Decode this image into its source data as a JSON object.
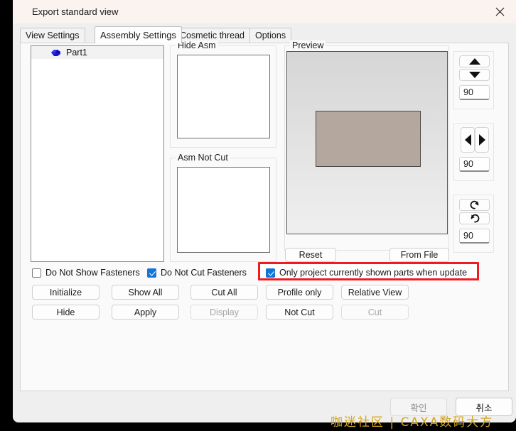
{
  "window": {
    "title": "Export standard view",
    "close_icon": "close-icon"
  },
  "tabs": [
    {
      "label": "View Settings",
      "selected": false
    },
    {
      "label": "Assembly Settings",
      "selected": true
    },
    {
      "label": "Cosmetic thread",
      "selected": false
    },
    {
      "label": "Options",
      "selected": false
    }
  ],
  "tree": {
    "items": [
      {
        "label": "Part1",
        "icon": "part-icon"
      }
    ]
  },
  "groups": {
    "hide_asm": "Hide Asm",
    "asm_not_cut": "Asm Not Cut",
    "preview": "Preview"
  },
  "checkboxes": [
    {
      "label": "Do Not Show Fasteners",
      "checked": false
    },
    {
      "label": "Do Not Cut Fasteners",
      "checked": true
    },
    {
      "label": "Only project currently shown parts when update",
      "checked": true,
      "highlighted": true
    }
  ],
  "buttons": {
    "initialize": {
      "label": "Initialize",
      "disabled": false
    },
    "show_all": {
      "label": "Show All",
      "disabled": false
    },
    "cut_all": {
      "label": "Cut All",
      "disabled": false
    },
    "hide": {
      "label": "Hide",
      "disabled": false
    },
    "apply": {
      "label": "Apply",
      "disabled": false
    },
    "display": {
      "label": "Display",
      "disabled": true
    },
    "reset": {
      "label": "Reset",
      "disabled": false
    },
    "from_file": {
      "label": "From File",
      "disabled": false
    },
    "profile_only": {
      "label": "Profile only",
      "disabled": false
    },
    "relative_view": {
      "label": "Relative View",
      "disabled": false
    },
    "not_cut": {
      "label": "Not Cut",
      "disabled": false
    },
    "cut": {
      "label": "Cut",
      "disabled": true
    },
    "ok": {
      "label": "확인",
      "disabled": true
    },
    "cancel": {
      "label": "취소",
      "disabled": false
    }
  },
  "spinners": [
    {
      "name": "vertical",
      "up_icon": "triangle-up-icon",
      "down_icon": "triangle-down-icon",
      "value": "90"
    },
    {
      "name": "horizontal",
      "left_icon": "triangle-left-icon",
      "right_icon": "triangle-right-icon",
      "value": "90"
    },
    {
      "name": "rotation",
      "ccw_icon": "rotate-counterclockwise-icon",
      "cw_icon": "rotate-clockwise-icon",
      "value": "90"
    }
  ],
  "watermark": "咖迷社区 | CAXA数码大方",
  "colors": {
    "accent": "#1176d8",
    "highlight": "#ef1b21",
    "titlebar": "#faf3f0",
    "preview_shape": "#b3a79e",
    "watermark": "#d4a521"
  }
}
